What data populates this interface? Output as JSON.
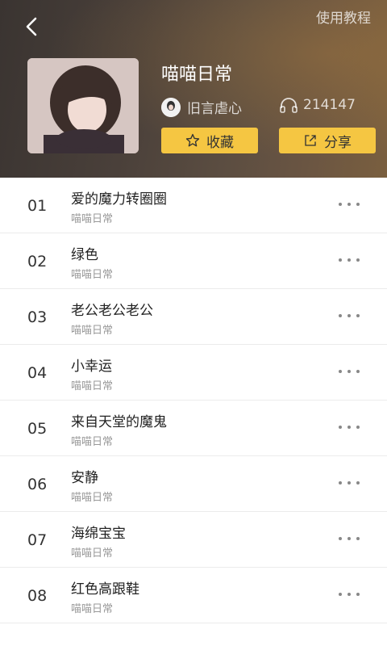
{
  "header": {
    "tutorial_link": "使用教程",
    "title": "喵喵日常",
    "author": "旧言虐心",
    "play_count": "214147",
    "favorite_label": "收藏",
    "share_label": "分享"
  },
  "songs": [
    {
      "index": "01",
      "title": "爱的魔力转圈圈",
      "artist": "喵喵日常"
    },
    {
      "index": "02",
      "title": "绿色",
      "artist": "喵喵日常"
    },
    {
      "index": "03",
      "title": "老公老公老公",
      "artist": "喵喵日常"
    },
    {
      "index": "04",
      "title": "小幸运",
      "artist": "喵喵日常"
    },
    {
      "index": "05",
      "title": "来自天堂的魔鬼",
      "artist": "喵喵日常"
    },
    {
      "index": "06",
      "title": "安静",
      "artist": "喵喵日常"
    },
    {
      "index": "07",
      "title": "海绵宝宝",
      "artist": "喵喵日常"
    },
    {
      "index": "08",
      "title": "红色高跟鞋",
      "artist": "喵喵日常"
    }
  ],
  "colors": {
    "accent_button": "#f5c642",
    "header_dark": "#3a3431",
    "header_warm": "#7a5f3f"
  }
}
